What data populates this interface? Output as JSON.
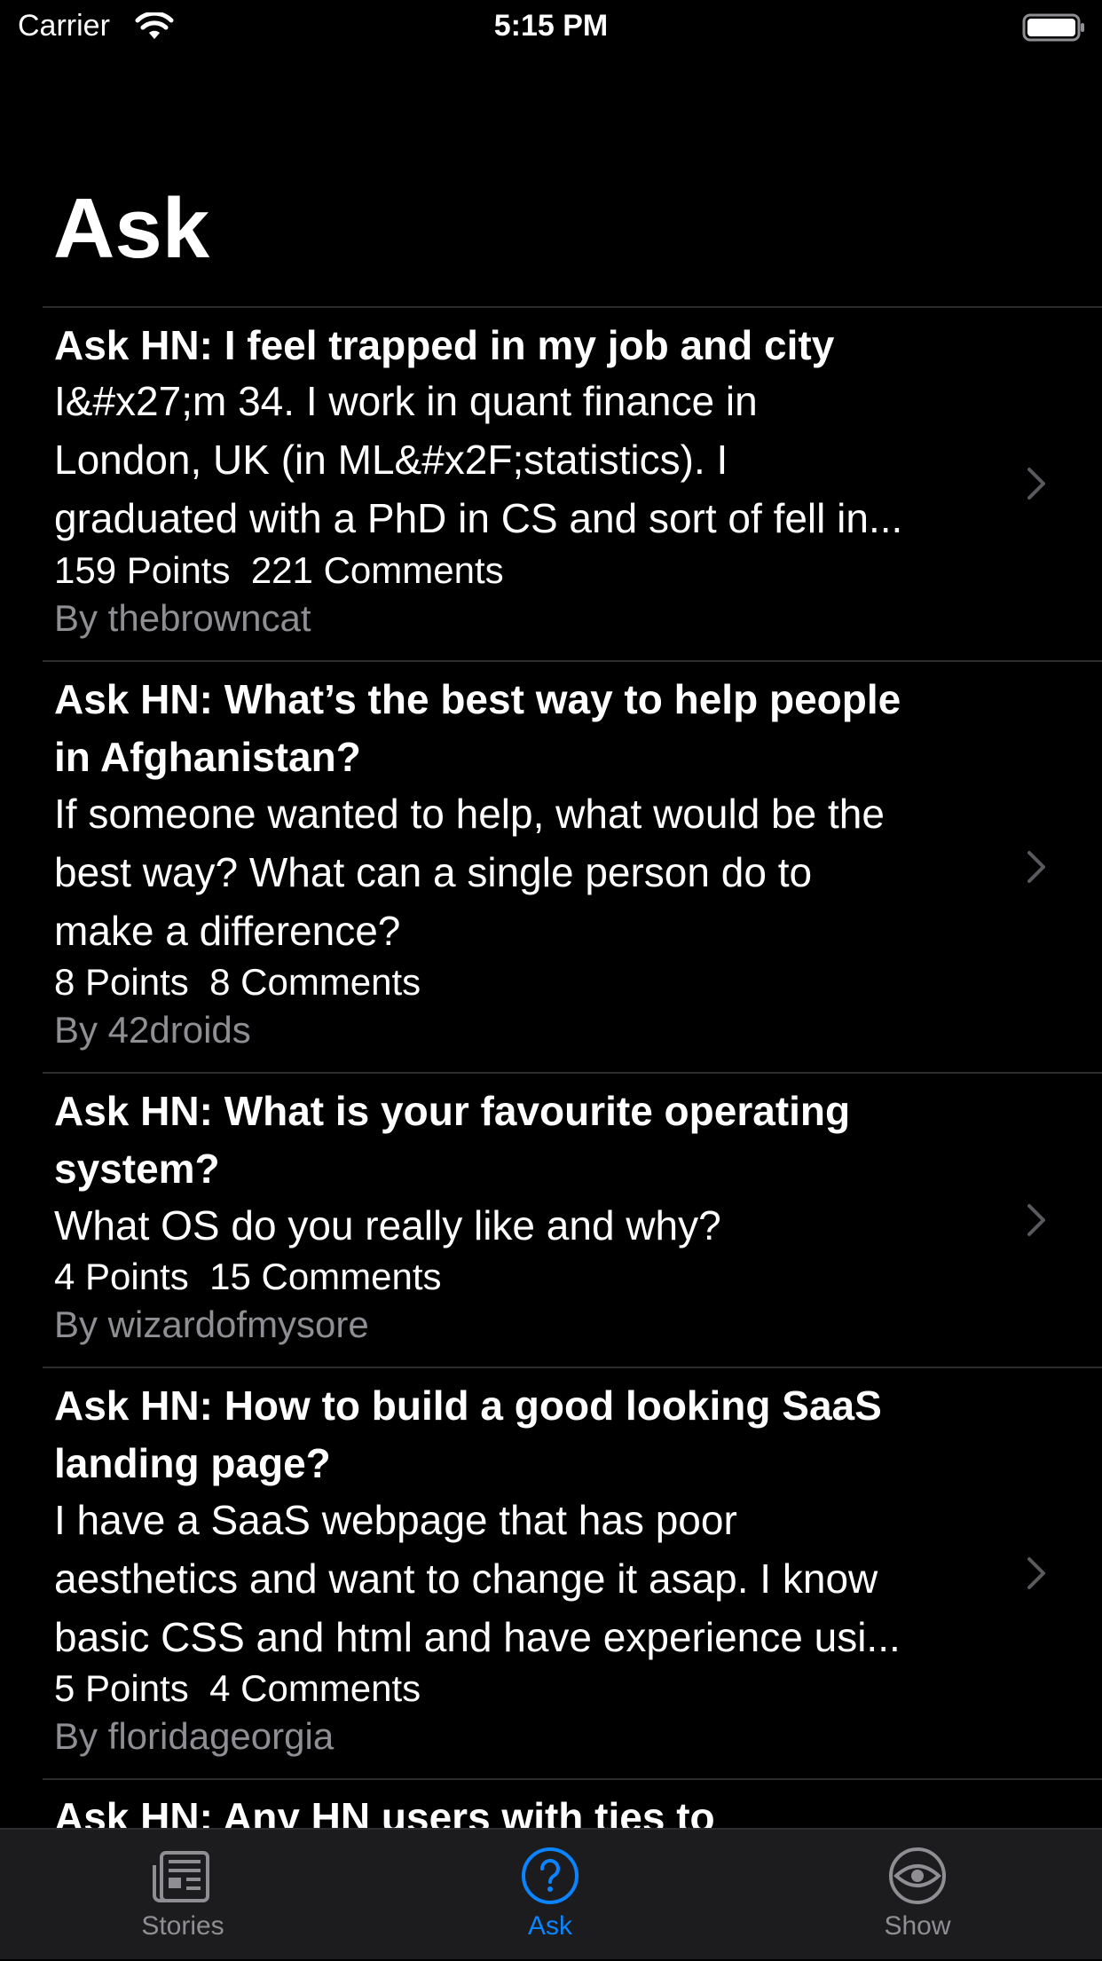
{
  "status_bar": {
    "carrier": "Carrier",
    "time": "5:15 PM"
  },
  "page": {
    "title": "Ask"
  },
  "stories": [
    {
      "title_lines": [
        "Ask HN: I feel trapped in my job and city"
      ],
      "body_lines": [
        "I&#x27;m 34. I work in quant finance in",
        "London, UK (in ML&#x2F;statistics). I",
        "graduated with a PhD in CS and sort of fell in..."
      ],
      "points": "159 Points",
      "comments": "221 Comments",
      "author": "By thebrowncat"
    },
    {
      "title_lines": [
        "Ask HN: What’s the best way to help people",
        "in Afghanistan?"
      ],
      "body_lines": [
        "If someone wanted to help, what would be the",
        "best way? What can a single person do to",
        "make a difference?"
      ],
      "points": "8 Points",
      "comments": "8 Comments",
      "author": "By 42droids"
    },
    {
      "title_lines": [
        "Ask HN: What is your favourite operating",
        "system?"
      ],
      "body_lines": [
        "What OS do you really like and why?"
      ],
      "points": "4 Points",
      "comments": "15 Comments",
      "author": "By wizardofmysore"
    },
    {
      "title_lines": [
        "Ask HN: How to build a good looking SaaS",
        "landing page?"
      ],
      "body_lines": [
        "I have a SaaS webpage that has poor",
        "aesthetics and want to change it asap. I know",
        "basic CSS and html and have experience usi..."
      ],
      "points": "5 Points",
      "comments": "4 Comments",
      "author": "By floridageorgia"
    },
    {
      "title_lines": [
        "Ask HN: Any HN users with ties to"
      ],
      "body_lines": [],
      "points": "",
      "comments": "",
      "author": ""
    }
  ],
  "tab_bar": {
    "active_color": "#0a84ff",
    "inactive_color": "#8e8e93",
    "tabs": [
      {
        "label": "Stories",
        "icon": "newspaper-icon",
        "active": false
      },
      {
        "label": "Ask",
        "icon": "question-circle-icon",
        "active": true
      },
      {
        "label": "Show",
        "icon": "eye-icon",
        "active": false
      }
    ]
  }
}
